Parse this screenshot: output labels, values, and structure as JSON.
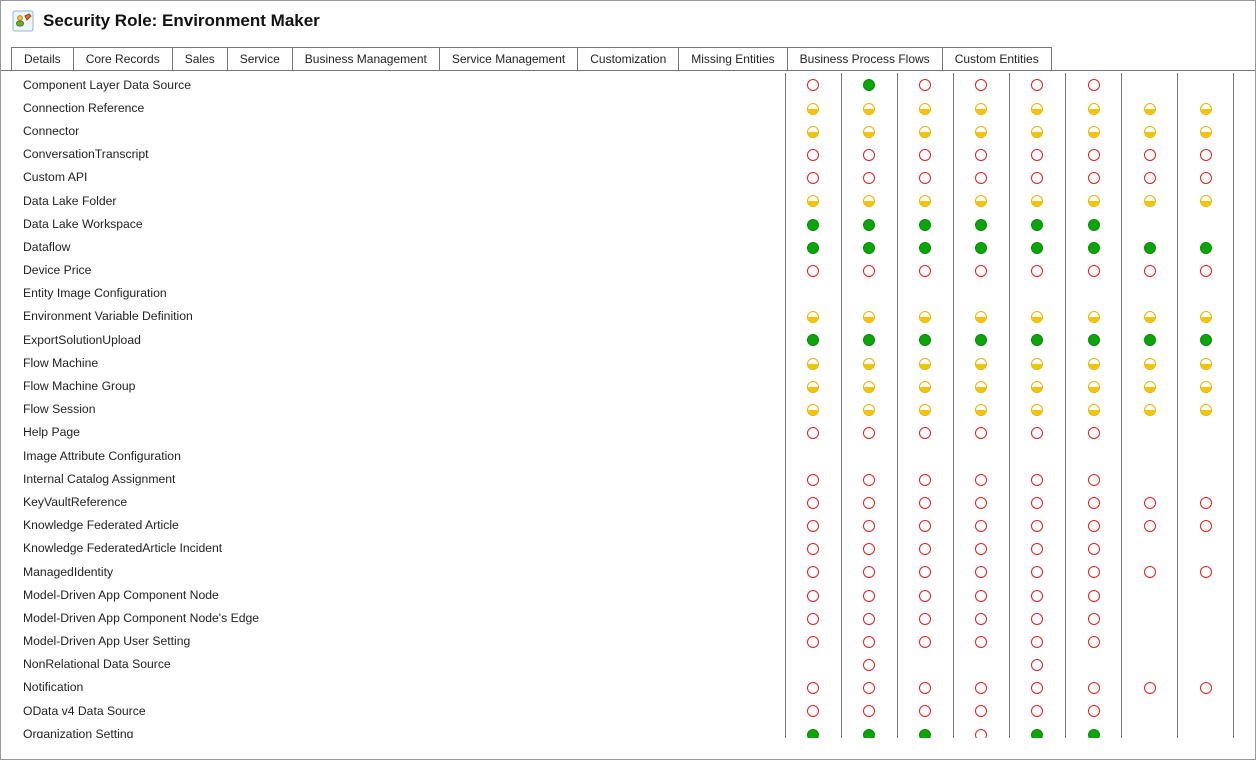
{
  "title": "Security Role: Environment Maker",
  "tabs": [
    "Details",
    "Core Records",
    "Sales",
    "Service",
    "Business Management",
    "Service Management",
    "Customization",
    "Missing Entities",
    "Business Process Flows",
    "Custom Entities"
  ],
  "permission_columns": 8,
  "entities": [
    {
      "name": "Component Layer Data Source",
      "perms": [
        "none",
        "org",
        "none",
        "none",
        "none",
        "none",
        "",
        ""
      ]
    },
    {
      "name": "Connection Reference",
      "perms": [
        "bu",
        "bu",
        "bu",
        "bu",
        "bu",
        "bu",
        "bu",
        "bu"
      ]
    },
    {
      "name": "Connector",
      "perms": [
        "bu",
        "bu",
        "bu",
        "bu",
        "bu",
        "bu",
        "bu",
        "bu"
      ]
    },
    {
      "name": "ConversationTranscript",
      "perms": [
        "none",
        "none",
        "none",
        "none",
        "none",
        "none",
        "none",
        "none"
      ]
    },
    {
      "name": "Custom API",
      "perms": [
        "none",
        "none",
        "none",
        "none",
        "none",
        "none",
        "none",
        "none"
      ]
    },
    {
      "name": "Data Lake Folder",
      "perms": [
        "bu",
        "bu",
        "bu",
        "bu",
        "bu",
        "bu",
        "bu",
        "bu"
      ]
    },
    {
      "name": "Data Lake Workspace",
      "perms": [
        "org",
        "org",
        "org",
        "org",
        "org",
        "org",
        "",
        ""
      ]
    },
    {
      "name": "Dataflow",
      "perms": [
        "org",
        "org",
        "org",
        "org",
        "org",
        "org",
        "org",
        "org"
      ]
    },
    {
      "name": "Device Price",
      "perms": [
        "none",
        "none",
        "none",
        "none",
        "none",
        "none",
        "none",
        "none"
      ]
    },
    {
      "name": "Entity Image Configuration",
      "perms": [
        "",
        "",
        "",
        "",
        "",
        "",
        "",
        ""
      ]
    },
    {
      "name": "Environment Variable Definition",
      "perms": [
        "bu",
        "bu",
        "bu",
        "bu",
        "bu",
        "bu",
        "bu",
        "bu"
      ]
    },
    {
      "name": "ExportSolutionUpload",
      "perms": [
        "org",
        "org",
        "org",
        "org",
        "org",
        "org",
        "org",
        "org"
      ]
    },
    {
      "name": "Flow Machine",
      "perms": [
        "bu",
        "bu",
        "bu",
        "bu",
        "bu",
        "bu",
        "bu",
        "bu"
      ]
    },
    {
      "name": "Flow Machine Group",
      "perms": [
        "bu",
        "bu",
        "bu",
        "bu",
        "bu",
        "bu",
        "bu",
        "bu"
      ]
    },
    {
      "name": "Flow Session",
      "perms": [
        "bu",
        "bu",
        "bu",
        "bu",
        "bu",
        "bu",
        "bu",
        "bu"
      ]
    },
    {
      "name": "Help Page",
      "perms": [
        "none",
        "none",
        "none",
        "none",
        "none",
        "none",
        "",
        ""
      ]
    },
    {
      "name": "Image Attribute Configuration",
      "perms": [
        "",
        "",
        "",
        "",
        "",
        "",
        "",
        ""
      ]
    },
    {
      "name": "Internal Catalog Assignment",
      "perms": [
        "none",
        "none",
        "none",
        "none",
        "none",
        "none",
        "",
        ""
      ]
    },
    {
      "name": "KeyVaultReference",
      "perms": [
        "none",
        "none",
        "none",
        "none",
        "none",
        "none",
        "none",
        "none"
      ]
    },
    {
      "name": "Knowledge Federated Article",
      "perms": [
        "none",
        "none",
        "none",
        "none",
        "none",
        "none",
        "none",
        "none"
      ]
    },
    {
      "name": "Knowledge FederatedArticle Incident",
      "perms": [
        "none",
        "none",
        "none",
        "none",
        "none",
        "none",
        "",
        ""
      ]
    },
    {
      "name": "ManagedIdentity",
      "perms": [
        "none",
        "none",
        "none",
        "none",
        "none",
        "none",
        "none",
        "none"
      ]
    },
    {
      "name": "Model-Driven App Component Node",
      "perms": [
        "none",
        "none",
        "none",
        "none",
        "none",
        "none",
        "",
        ""
      ]
    },
    {
      "name": "Model-Driven App Component Node's Edge",
      "perms": [
        "none",
        "none",
        "none",
        "none",
        "none",
        "none",
        "",
        ""
      ]
    },
    {
      "name": "Model-Driven App User Setting",
      "perms": [
        "none",
        "none",
        "none",
        "none",
        "none",
        "none",
        "",
        ""
      ]
    },
    {
      "name": "NonRelational Data Source",
      "perms": [
        "",
        "none",
        "",
        "",
        "none",
        "",
        "",
        ""
      ]
    },
    {
      "name": "Notification",
      "perms": [
        "none",
        "none",
        "none",
        "none",
        "none",
        "none",
        "none",
        "none"
      ]
    },
    {
      "name": "OData v4 Data Source",
      "perms": [
        "none",
        "none",
        "none",
        "none",
        "none",
        "none",
        "",
        ""
      ]
    },
    {
      "name": "Organization Setting",
      "perms": [
        "org",
        "org",
        "org",
        "none",
        "org",
        "org",
        "",
        ""
      ]
    }
  ]
}
